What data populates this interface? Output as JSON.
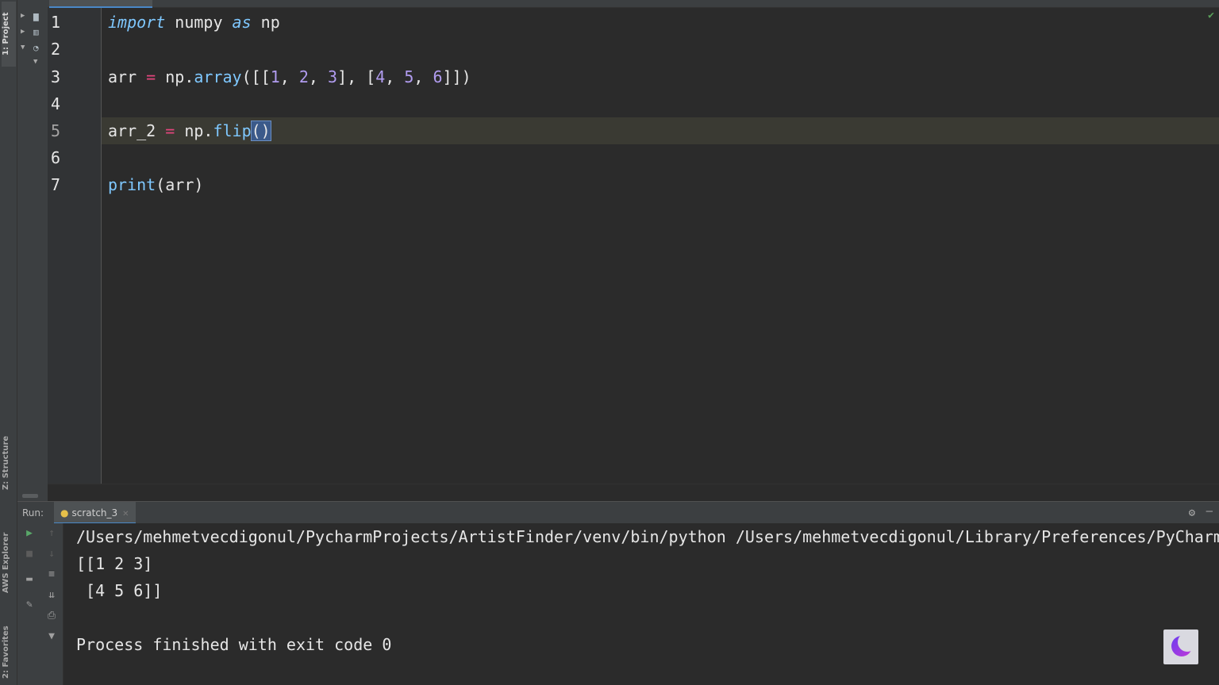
{
  "tool_strip": {
    "tabs": [
      {
        "label": "1: Project",
        "top": 0
      },
      {
        "label": "Z: Structure",
        "top": 0
      },
      {
        "label": "AWS Explorer",
        "top": 0
      },
      {
        "label": "2: Favorites",
        "top": 0
      }
    ]
  },
  "editor": {
    "lines": [
      {
        "no": "1"
      },
      {
        "no": "2"
      },
      {
        "no": "3"
      },
      {
        "no": "4"
      },
      {
        "no": "5"
      },
      {
        "no": "6"
      },
      {
        "no": "7"
      }
    ],
    "code": {
      "l1_kw1": "import",
      "l1_mod": " numpy ",
      "l1_kw2": "as",
      "l1_alias": " np",
      "l3_var": "arr ",
      "l3_eq": "=",
      "l3_np": " np.",
      "l3_fn": "array",
      "l3_open": "([[",
      "l3_n1": "1",
      "l3_c1": ", ",
      "l3_n2": "2",
      "l3_c2": ", ",
      "l3_n3": "3",
      "l3_mid": "], [",
      "l3_n4": "4",
      "l3_c3": ", ",
      "l3_n5": "5",
      "l3_c4": ", ",
      "l3_n6": "6",
      "l3_close": "]])",
      "l5_var": "arr_2 ",
      "l5_eq": "=",
      "l5_np": " np.",
      "l5_fn": "flip",
      "l5_paren": "()",
      "l7_fn": "print",
      "l7_args": "(arr)"
    }
  },
  "run": {
    "label": "Run:",
    "tab_label": "scratch_3",
    "console": {
      "line1": "/Users/mehmetvecdigonul/PycharmProjects/ArtistFinder/venv/bin/python /Users/mehmetvecdigonul/Library/Preferences/PyCharmCE",
      "line2": "[[1 2 3]",
      "line3": " [4 5 6]]",
      "line4": "Process finished with exit code 0"
    }
  },
  "colors": {
    "keyword": "#7fc8ff",
    "number": "#b19cf0",
    "operator": "#e0457b",
    "background": "#2b2b2b"
  }
}
